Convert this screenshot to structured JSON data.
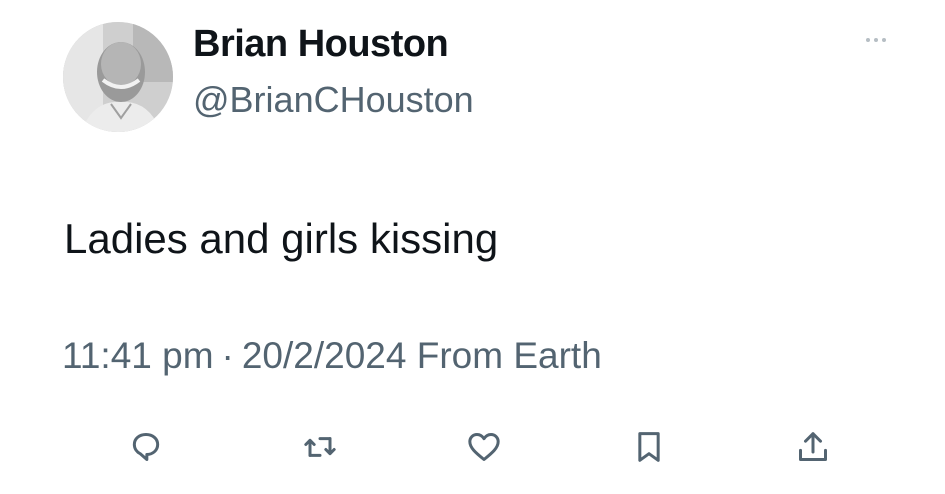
{
  "user": {
    "display_name": "Brian Houston",
    "handle": "@BrianCHouston",
    "avatar_icon": "profile-photo"
  },
  "tweet": {
    "text": "Ladies and girls kissing",
    "time": "11:41 pm",
    "separator": "·",
    "date": "20/2/2024",
    "source": "From Earth"
  },
  "actions": {
    "reply_icon": "reply-icon",
    "retweet_icon": "retweet-icon",
    "like_icon": "heart-icon",
    "bookmark_icon": "bookmark-icon",
    "share_icon": "share-icon",
    "more_icon": "more-icon"
  },
  "colors": {
    "text_primary": "#0f1419",
    "text_secondary": "#536471",
    "icon": "#536471",
    "background": "#ffffff"
  }
}
